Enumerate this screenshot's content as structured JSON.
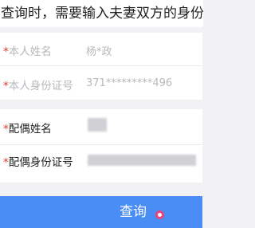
{
  "notice": {
    "text": "查询时，需要输入夫妻双方的身份信息"
  },
  "self": {
    "name_label": "本人姓名",
    "name_value": "杨*政",
    "id_label": "本人身份证号",
    "id_value": "371*********496"
  },
  "spouse": {
    "name_label": "配偶姓名",
    "id_label": "配偶身份证号"
  },
  "required_mark": "*",
  "footer": {
    "query_label": "查询"
  },
  "colors": {
    "accent": "#4a8df5",
    "required": "#e8322a"
  }
}
